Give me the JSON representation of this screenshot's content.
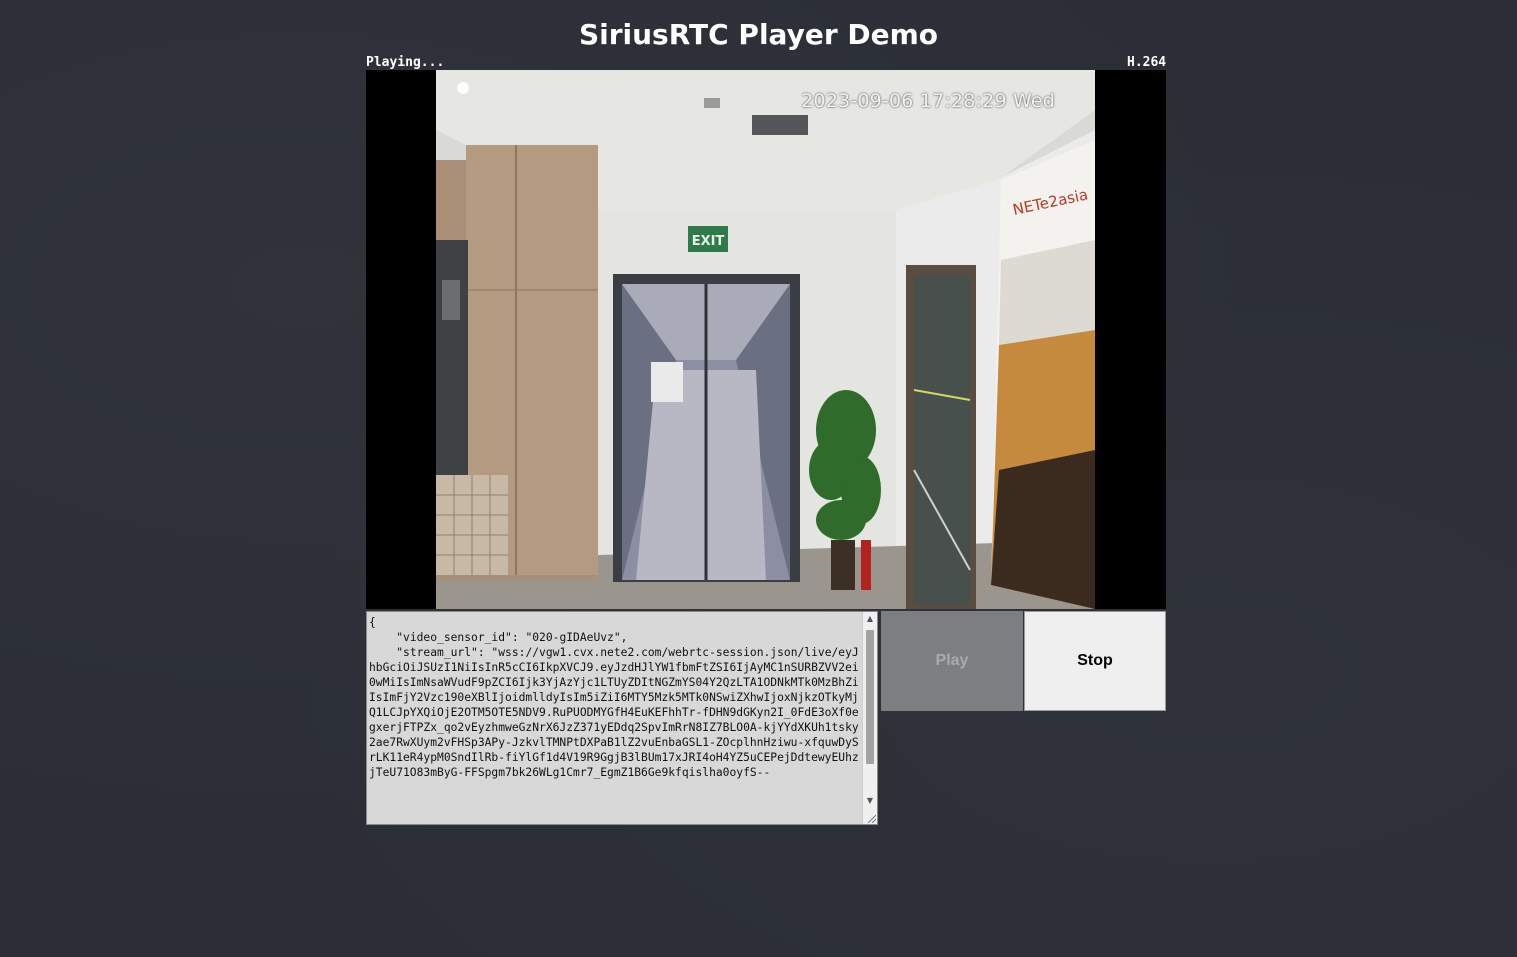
{
  "page": {
    "title": "SiriusRTC Player Demo"
  },
  "status": {
    "state": "Playing...",
    "codec": "H.264"
  },
  "video": {
    "timestamp_overlay": "2023-09-06 17:28:29 Wed",
    "exit_sign": "EXIT",
    "poster_brand": "NETe2asia"
  },
  "config_json": "{\n    \"video_sensor_id\": \"020-gIDAeUvz\",\n    \"stream_url\": \"wss://vgw1.cvx.nete2.com/webrtc-session.json/live/eyJhbGciOiJSUzI1NiIsInR5cCI6IkpXVCJ9.eyJzdHJlYW1fbmFtZSI6IjAyMC1nSURBZVV2ei0wMiIsImNsaWVudF9pZCI6Ijk3YjAzYjc1LTUyZDItNGZmYS04Y2QzLTA1ODNkMTk0MzBhZiIsImFjY2Vzc190eXBlIjoidmlldyIsIm5iZiI6MTY5Mzk5MTk0NSwiZXhwIjoxNjkzOTkyMjQ1LCJpYXQiOjE2OTM5OTE5NDV9.RuPUODMYGfH4EuKEFhhTr-fDHN9dGKyn2I_0FdE3oXf0egxerjFTPZx_qo2vEyzhmweGzNrX6JzZ371yEDdq2SpvImRrN8IZ7BLO0A-kjYYdXKUh1tsky2ae7RwXUym2vFHSp3APy-JzkvlTMNPtDXPaB1lZ2vuEnbaGSL1-ZOcplhnHziwu-xfquwDySrLK11eR4ypM0SndIlRb-fiYlGf1d4V19R9GgjB3lBUm17xJRI4oH4YZ5uCEPejDdtewyEUhzjTeU71O83mByG-FFSpgm7bk26WLg1Cmr7_EgmZ1B6Ge9kfqislha0oyfS--",
  "buttons": {
    "play_label": "Play",
    "stop_label": "Stop"
  },
  "icons": {
    "scroll_up": "triangle-up-icon",
    "scroll_down": "triangle-down-icon",
    "resize": "resize-grip-icon"
  }
}
